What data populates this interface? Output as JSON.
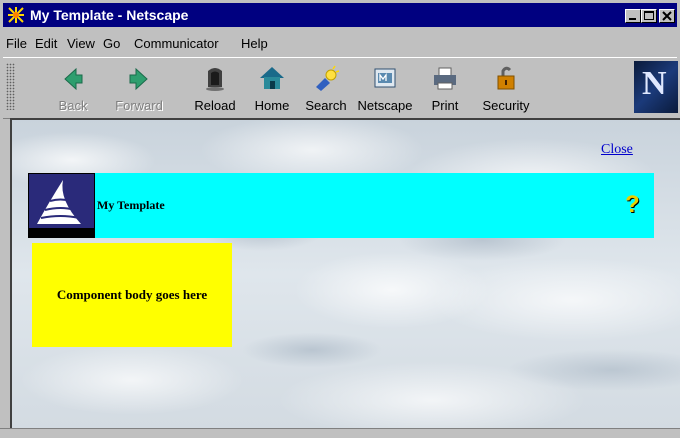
{
  "window": {
    "title": "My Template - Netscape",
    "controls": [
      "minimize",
      "maximize",
      "close"
    ]
  },
  "menu": {
    "items": [
      {
        "label": "File"
      },
      {
        "label": "Edit"
      },
      {
        "label": "View"
      },
      {
        "label": "Go"
      },
      {
        "label": "Communicator"
      },
      {
        "label": "Help"
      }
    ]
  },
  "toolbar": {
    "buttons": [
      {
        "label": "Back",
        "icon": "back-icon",
        "enabled": false
      },
      {
        "label": "Forward",
        "icon": "forward-icon",
        "enabled": false
      },
      {
        "label": "Reload",
        "icon": "reload-icon",
        "enabled": true
      },
      {
        "label": "Home",
        "icon": "home-icon",
        "enabled": true
      },
      {
        "label": "Search",
        "icon": "search-icon",
        "enabled": true
      },
      {
        "label": "Netscape",
        "icon": "netscape-icon",
        "enabled": true
      },
      {
        "label": "Print",
        "icon": "print-icon",
        "enabled": true
      },
      {
        "label": "Security",
        "icon": "security-icon",
        "enabled": true
      }
    ],
    "throbber": "N"
  },
  "page": {
    "close_link": "Close",
    "banner": {
      "title": "My Template",
      "help_glyph": "?",
      "color": "#00ffff"
    },
    "component": {
      "text": "Component body goes here",
      "color": "#ffff00"
    }
  },
  "colors": {
    "titlebar": "#000080",
    "chrome": "#c0c0c0",
    "link": "#0000cc"
  }
}
